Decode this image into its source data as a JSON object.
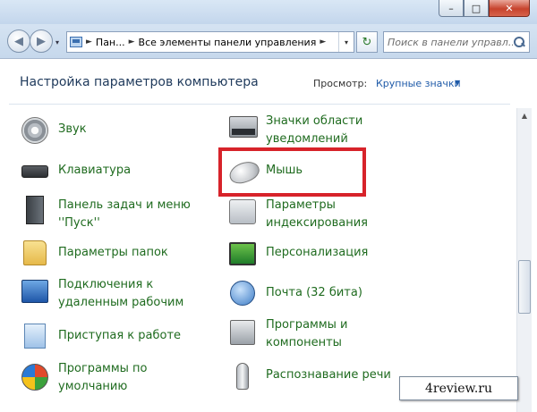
{
  "window": {
    "minimize_glyph": "–",
    "maximize_glyph": "□",
    "close_glyph": "✕"
  },
  "address_bar": {
    "back_glyph": "◀",
    "forward_glyph": "▶",
    "history_glyph": "▾",
    "separator": "►",
    "crumbs": [
      "Пан...",
      "Все элементы панели управления"
    ],
    "dropdown_glyph": "▾",
    "refresh_glyph": "↻",
    "search_placeholder": "Поиск в панели управл..."
  },
  "header": {
    "title": "Настройка параметров компьютера",
    "view_label": "Просмотр:",
    "view_value": "Крупные значки",
    "view_caret": "▼"
  },
  "scrollbar": {
    "up_glyph": "▲"
  },
  "items_left": [
    {
      "label": "Звук",
      "icon": "speaker-icon"
    },
    {
      "label": "Клавиатура",
      "icon": "keyboard-icon"
    },
    {
      "label": "Панель задач и меню ''Пуск''",
      "icon": "taskbar-icon"
    },
    {
      "label": "Параметры папок",
      "icon": "folder-icon"
    },
    {
      "label": "Подключения к удаленным рабочим",
      "icon": "remote-desktop-icon"
    },
    {
      "label": "Приступая к работе",
      "icon": "getting-started-icon"
    },
    {
      "label": "Программы по умолчанию",
      "icon": "default-programs-icon"
    }
  ],
  "items_right": [
    {
      "label": "Значки области уведомлений",
      "icon": "notification-tray-icon"
    },
    {
      "label": "Мышь",
      "icon": "mouse-icon"
    },
    {
      "label": "Параметры индексирования",
      "icon": "indexing-icon"
    },
    {
      "label": "Персонализация",
      "icon": "personalization-icon"
    },
    {
      "label": "Почта (32 бита)",
      "icon": "mail-icon"
    },
    {
      "label": "Программы и компоненты",
      "icon": "programs-features-icon"
    },
    {
      "label": "Распознавание речи",
      "icon": "microphone-icon"
    }
  ],
  "watermark": "4review.ru",
  "colors": {
    "link_green": "#1f6b1f",
    "title_blue": "#1e395b",
    "highlight_red": "#d7232a"
  }
}
